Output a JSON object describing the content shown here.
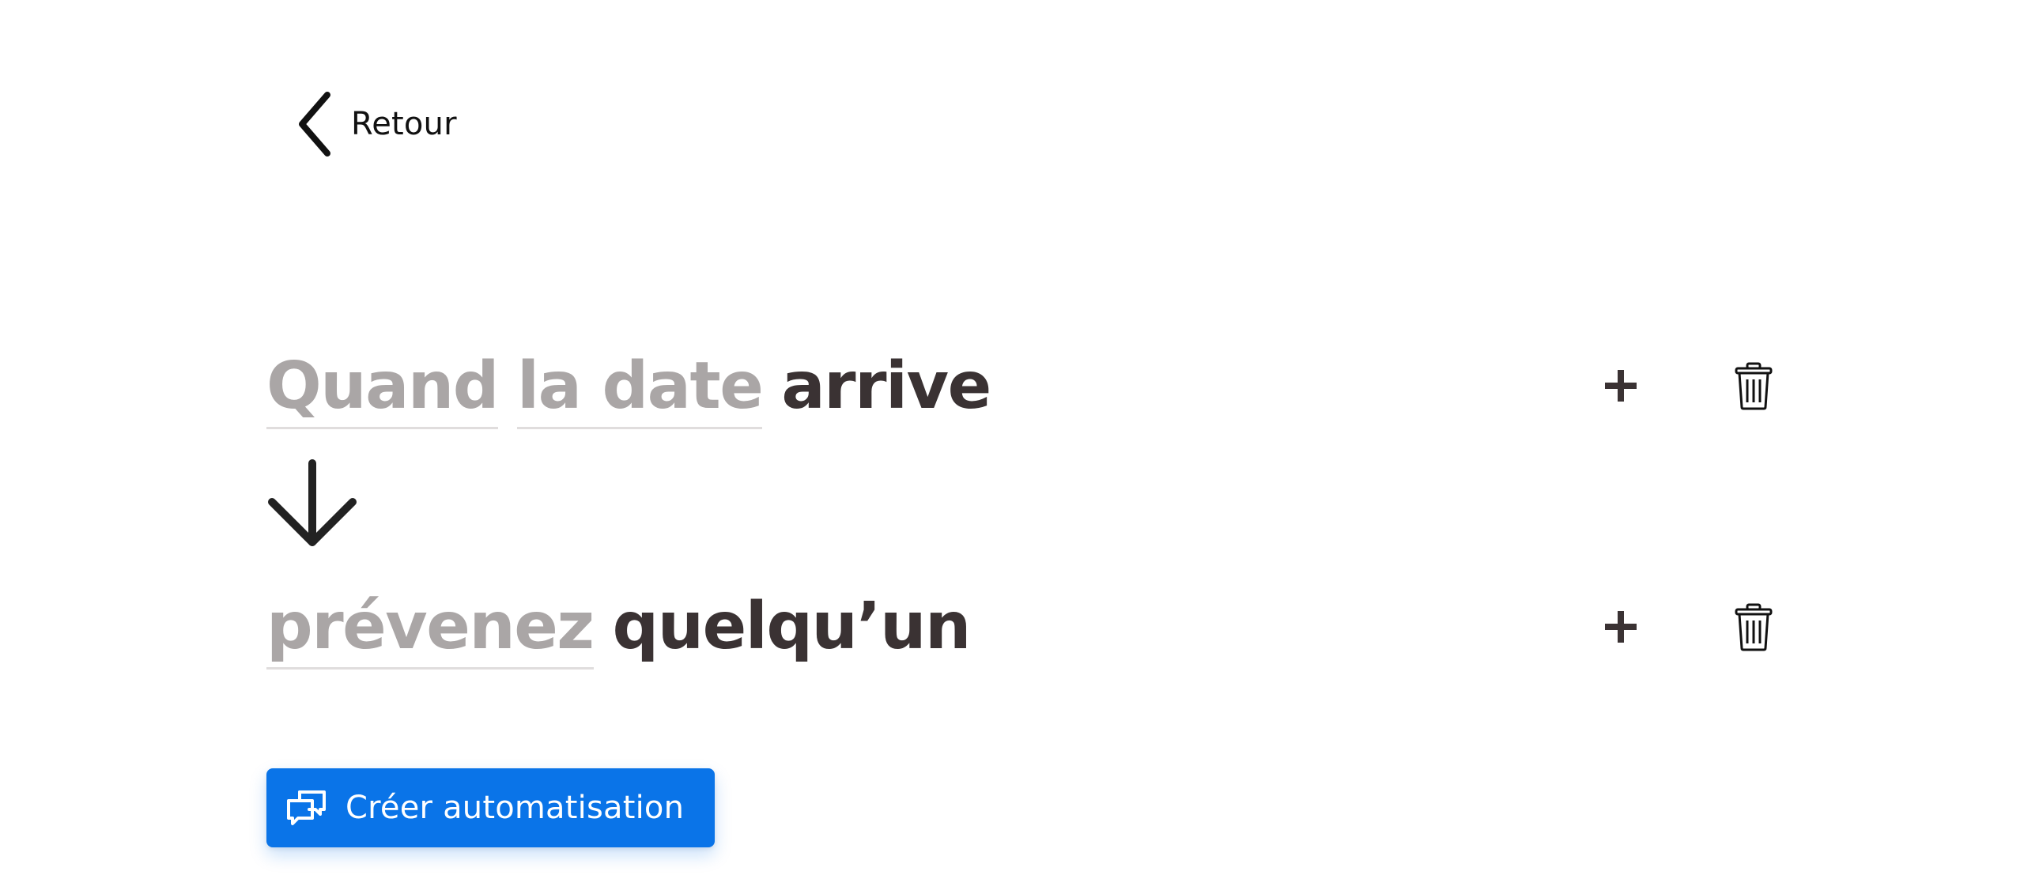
{
  "back": {
    "label": "Retour",
    "icon": "chevron-left-icon"
  },
  "trigger": {
    "subject": "Quand",
    "field": "la date",
    "verb": "arrive"
  },
  "action_step": {
    "verb": "prévenez",
    "object": "quelqu’un"
  },
  "icons": {
    "flow_arrow": "arrow-down-icon",
    "add": "plus-icon",
    "delete": "trash-icon",
    "create": "chat-bubbles-icon"
  },
  "create_button": {
    "label": "Créer automatisation"
  },
  "colors": {
    "accent": "#0a74e8",
    "text_dark": "#3a3233",
    "text_placeholder": "#aaa6a6"
  }
}
